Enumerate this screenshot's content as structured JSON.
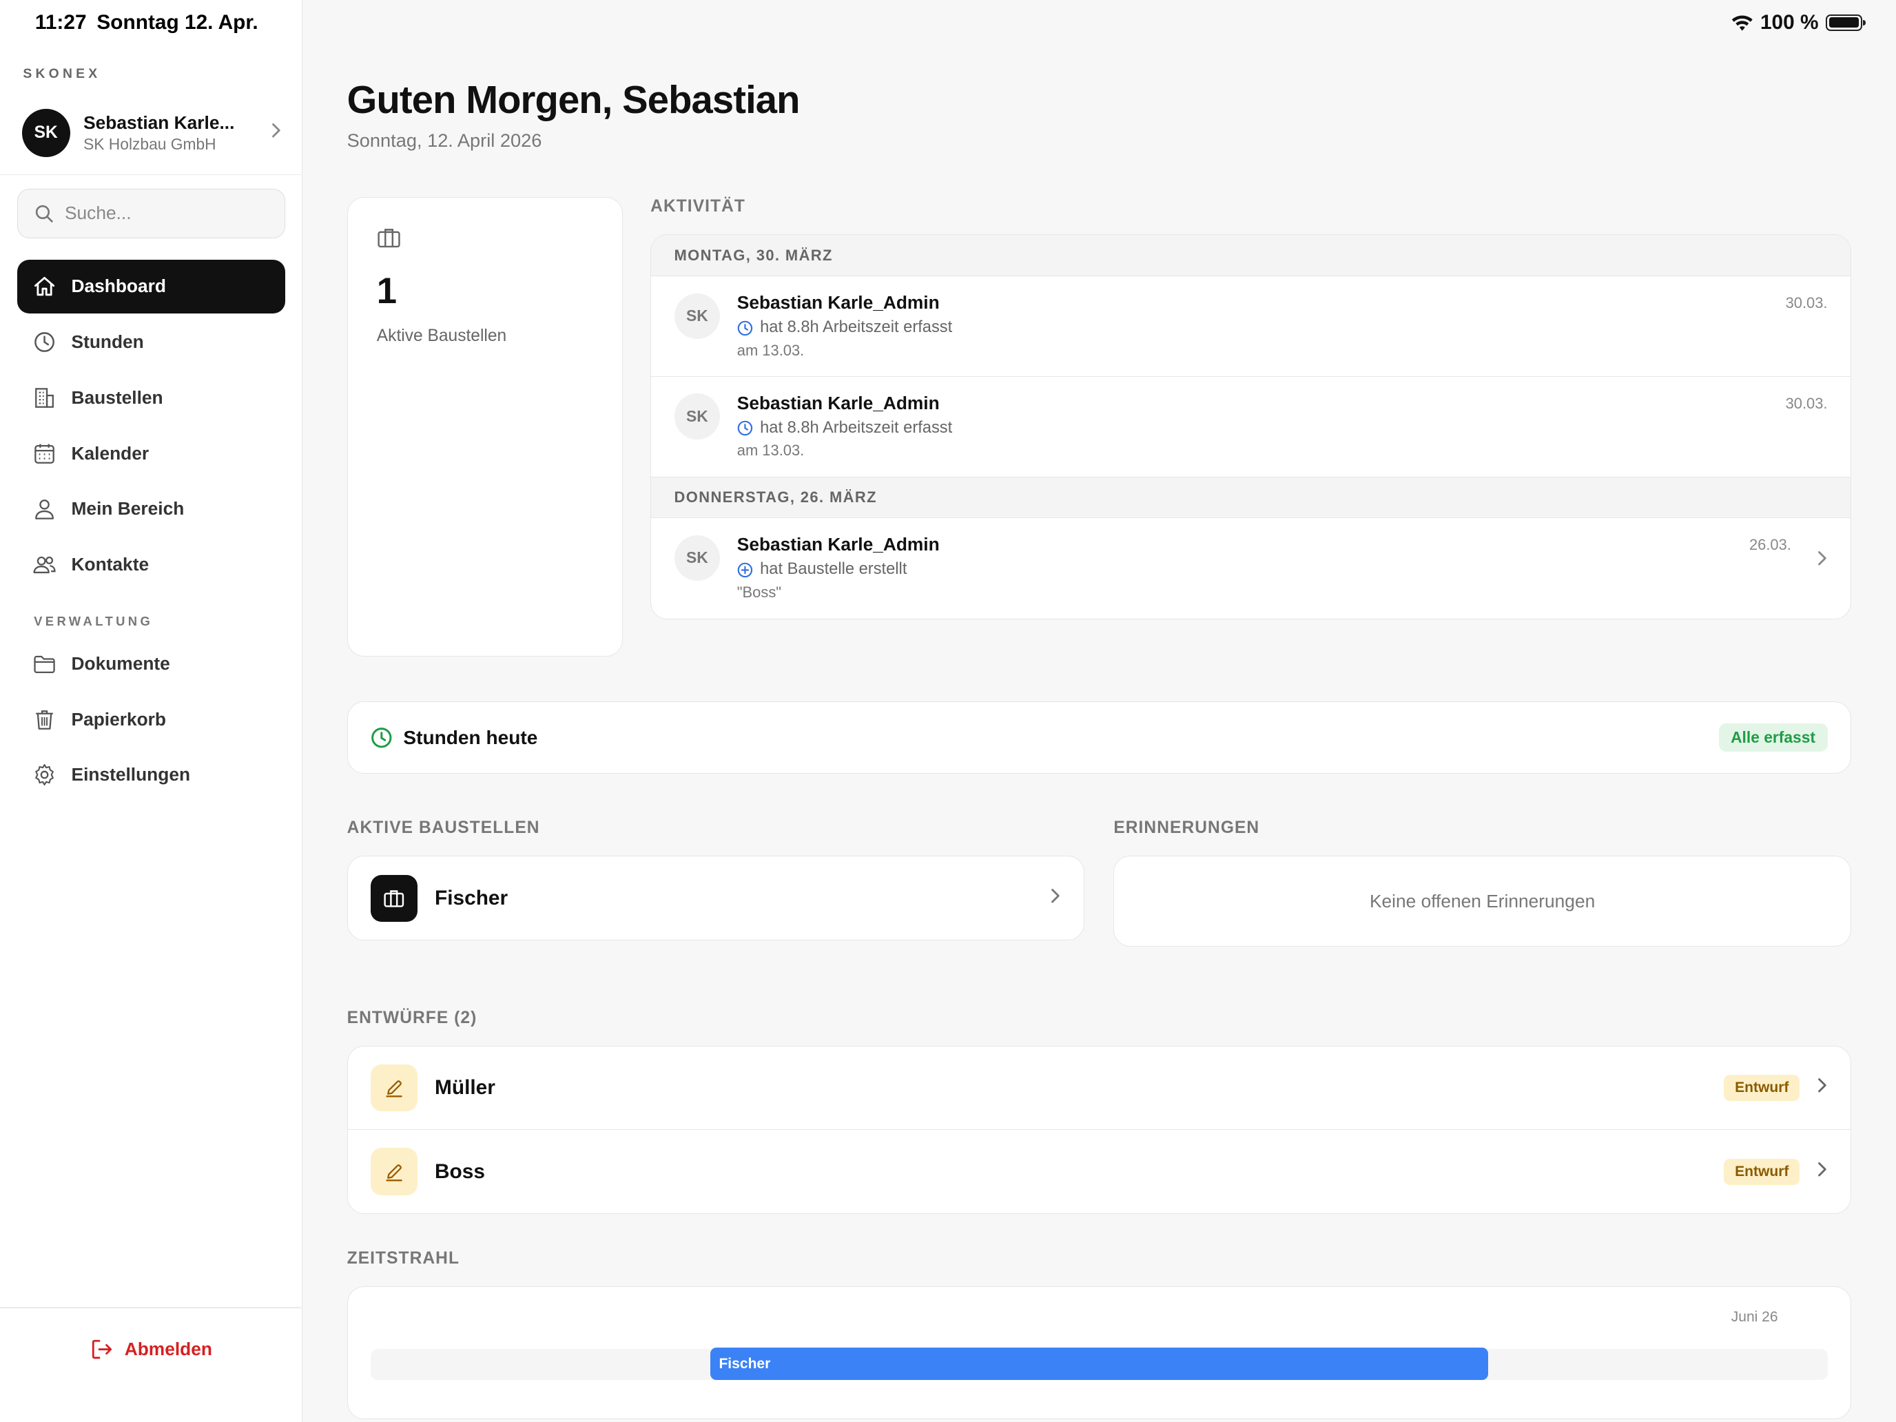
{
  "status_bar": {
    "time": "11:27",
    "date": "Sonntag 12. Apr.",
    "battery": "100 %"
  },
  "sidebar": {
    "brand": "SKONEX",
    "profile": {
      "initials": "SK",
      "name": "Sebastian Karle...",
      "company": "SK Holzbau GmbH"
    },
    "search_placeholder": "Suche...",
    "nav": [
      {
        "label": "Dashboard",
        "icon": "home-icon",
        "active": true
      },
      {
        "label": "Stunden",
        "icon": "clock-icon"
      },
      {
        "label": "Baustellen",
        "icon": "building-icon"
      },
      {
        "label": "Kalender",
        "icon": "calendar-icon"
      },
      {
        "label": "Mein Bereich",
        "icon": "user-icon"
      },
      {
        "label": "Kontakte",
        "icon": "users-icon"
      }
    ],
    "section_admin": "VERWALTUNG",
    "nav_admin": [
      {
        "label": "Dokumente",
        "icon": "folder-icon"
      },
      {
        "label": "Papierkorb",
        "icon": "trash-icon"
      },
      {
        "label": "Einstellungen",
        "icon": "gear-icon"
      }
    ],
    "logout": "Abmelden"
  },
  "main": {
    "greeting": "Guten Morgen, Sebastian",
    "date": "Sonntag, 12. April 2026",
    "stat": {
      "value": "1",
      "label": "Aktive Baustellen"
    },
    "activity": {
      "title": "AKTIVITÄT",
      "groups": [
        {
          "heading": "MONTAG, 30. MÄRZ",
          "items": [
            {
              "initials": "SK",
              "name": "Sebastian Karle_Admin",
              "action": "hat 8.8h Arbeitszeit erfasst",
              "detail": "am 13.03.",
              "date": "30.03."
            },
            {
              "initials": "SK",
              "name": "Sebastian Karle_Admin",
              "action": "hat 8.8h Arbeitszeit erfasst",
              "detail": "am 13.03.",
              "date": "30.03."
            }
          ]
        },
        {
          "heading": "DONNERSTAG, 26. MÄRZ",
          "items": [
            {
              "initials": "SK",
              "name": "Sebastian Karle_Admin",
              "action": "hat Baustelle erstellt",
              "detail": "\"Boss\"",
              "date": "26.03."
            }
          ]
        }
      ]
    },
    "hours_today": {
      "title": "Stunden heute",
      "status": "Alle erfasst"
    },
    "active_sites": {
      "title": "AKTIVE BAUSTELLEN",
      "items": [
        {
          "name": "Fischer"
        }
      ]
    },
    "reminders": {
      "title": "ERINNERUNGEN",
      "empty": "Keine offenen Erinnerungen"
    },
    "drafts": {
      "title": "ENTWÜRFE (2)",
      "items": [
        {
          "name": "Müller",
          "badge": "Entwurf"
        },
        {
          "name": "Boss",
          "badge": "Entwurf"
        }
      ]
    },
    "timeline": {
      "title": "ZEITSTRAHL",
      "month": "Juni 26",
      "bar_label": "Fischer"
    }
  },
  "colors": {
    "accent": "#111111",
    "timeline_bar": "#3b82f6",
    "success": "#1f9d45",
    "danger": "#d62020",
    "draft_badge_bg": "#fdf0c8"
  }
}
